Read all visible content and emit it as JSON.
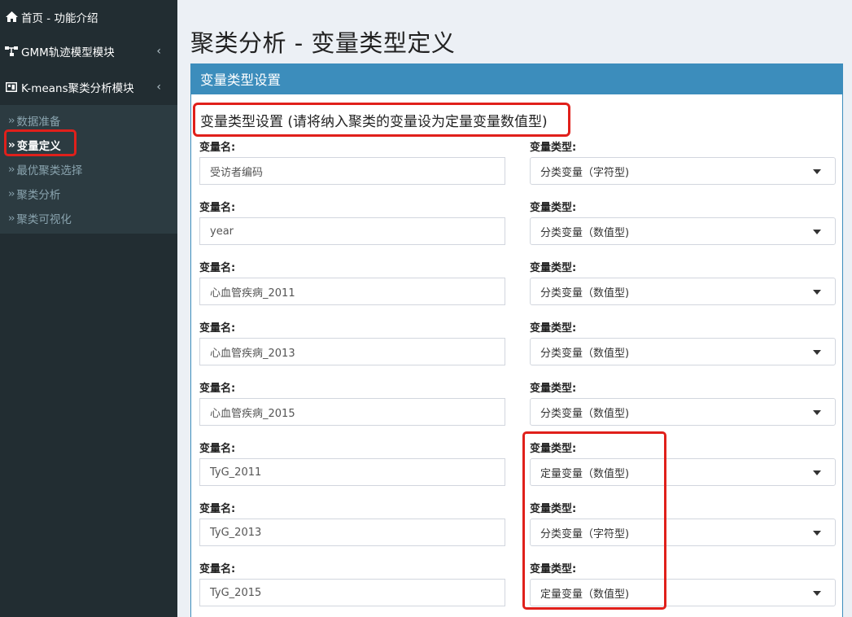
{
  "sidebar": {
    "items": [
      {
        "label": "首页 - 功能介绍",
        "icon": "home-icon"
      },
      {
        "label": "GMM轨迹模型模块",
        "icon": "sitemap-icon"
      },
      {
        "label": "K-means聚类分析模块",
        "icon": "chart-icon"
      }
    ],
    "submenu": [
      {
        "label": "数据准备"
      },
      {
        "label": "变量定义",
        "active": true
      },
      {
        "label": "最优聚类选择"
      },
      {
        "label": "聚类分析"
      },
      {
        "label": "聚类可视化"
      }
    ]
  },
  "page": {
    "title": "聚类分析 - 变量类型定义"
  },
  "box": {
    "header": "变量类型设置",
    "section_title": "变量类型设置 (请将纳入聚类的变量设为定量变量数值型)"
  },
  "labels": {
    "var_name": "变量名:",
    "var_type": "变量类型:"
  },
  "rows": [
    {
      "name": "受访者编码",
      "type": "分类变量（字符型)"
    },
    {
      "name": "year",
      "type": "分类变量（数值型)"
    },
    {
      "name": "心血管疾病_2011",
      "type": "分类变量（数值型)"
    },
    {
      "name": "心血管疾病_2013",
      "type": "分类变量（数值型)"
    },
    {
      "name": "心血管疾病_2015",
      "type": "分类变量（数值型)"
    },
    {
      "name": "TyG_2011",
      "type": "定量变量（数值型)"
    },
    {
      "name": "TyG_2013",
      "type": "分类变量（字符型)"
    },
    {
      "name": "TyG_2015",
      "type": "定量变量（数值型)"
    }
  ],
  "colors": {
    "sidebar_bg": "#222d32",
    "submenu_bg": "#2c3b41",
    "accent": "#3c8dbc",
    "highlight": "#e0201b"
  }
}
